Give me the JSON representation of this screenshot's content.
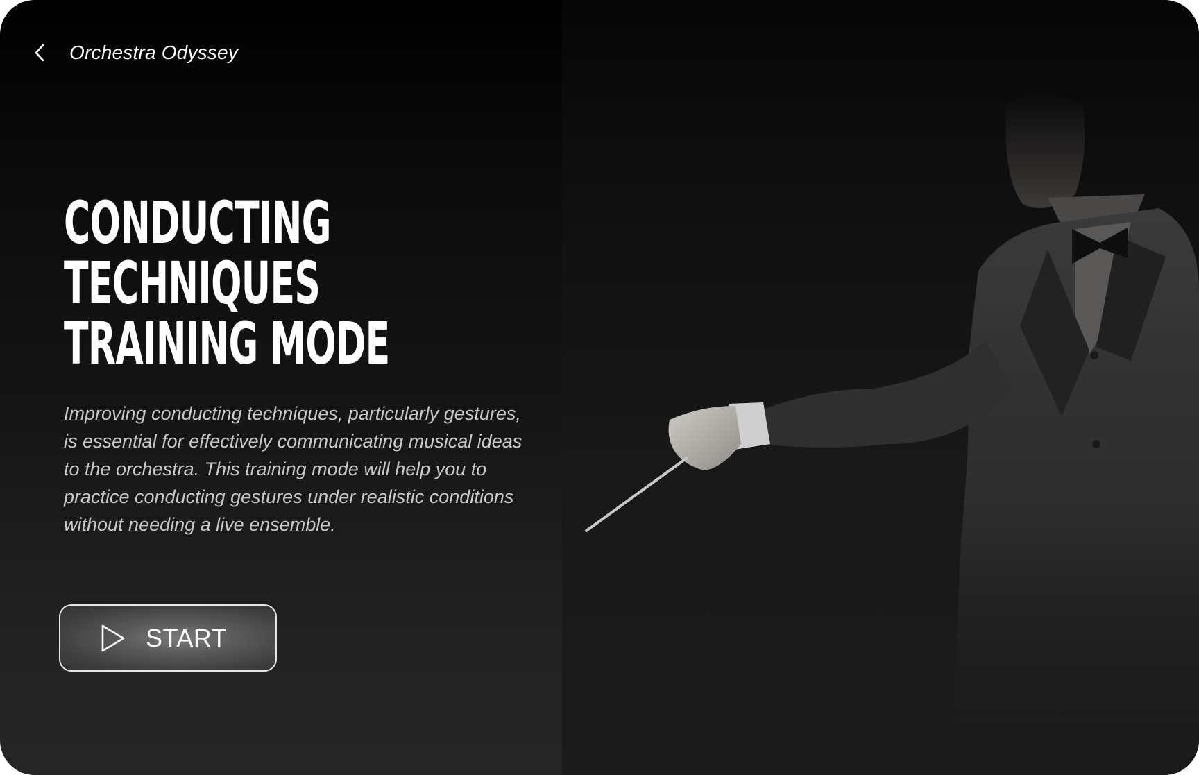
{
  "header": {
    "back_icon": "chevron-left-icon",
    "app_title": "Orchestra Odyssey"
  },
  "hero": {
    "title_lines": [
      "CONDUCTING",
      "TECHNIQUES",
      "TRAINING MODE"
    ],
    "description": "Improving conducting techniques, particularly gestures, is essential for effectively communicating musical ideas to the orchestra. This training mode will help you to practice conducting gestures under realistic conditions without needing a live ensemble."
  },
  "start_button": {
    "icon": "play-icon",
    "label": "START"
  },
  "colors": {
    "background_top": "#000000",
    "background_bottom": "#262626",
    "title_text": "#ffffff",
    "body_text": "#c9c9c9",
    "button_border": "#e6e6e6"
  }
}
